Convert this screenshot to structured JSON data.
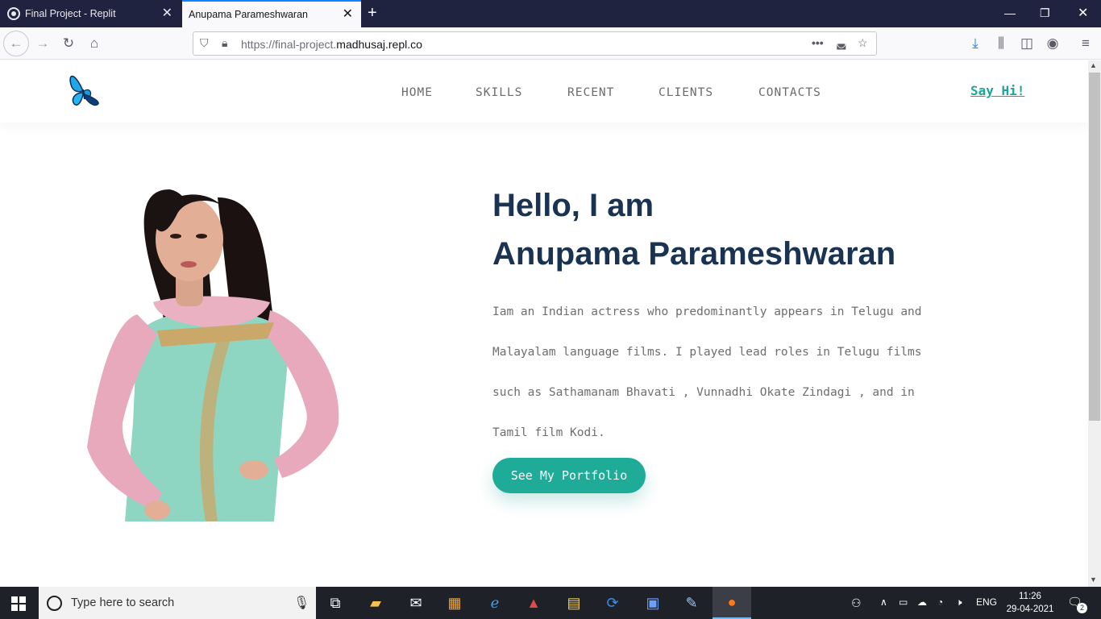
{
  "browser": {
    "tabs": [
      {
        "title": "Final Project - Replit",
        "active": false
      },
      {
        "title": "Anupama Parameshwaran",
        "active": true
      }
    ],
    "new_tab": "+",
    "url_prefix": "https://final-project.",
    "url_host": "madhusaj.repl.co",
    "url_suffix": ""
  },
  "site": {
    "logo": "butterfly-logo",
    "nav": [
      "HOME",
      "SKILLS",
      "RECENT",
      "CLIENTS",
      "CONTACTS"
    ],
    "say_hi": "Say Hi!",
    "hero": {
      "greeting": "Hello, I am",
      "name": "Anupama Parameshwaran",
      "bio_lines": [
        "Iam an Indian actress who predominantly appears in Telugu and",
        "Malayalam language films. I played lead roles in Telugu films",
        "such as Sathamanam Bhavati , Vunnadhi Okate Zindagi , and in",
        "Tamil film Kodi."
      ],
      "cta": "See My Portfolio"
    }
  },
  "taskbar": {
    "search_placeholder": "Type here to search",
    "language": "ENG",
    "time": "11:26",
    "date": "29-04-2021",
    "notifications": "2"
  },
  "colors": {
    "accent": "#1eab98",
    "heading": "#1a3353",
    "tabbar": "#202340"
  }
}
